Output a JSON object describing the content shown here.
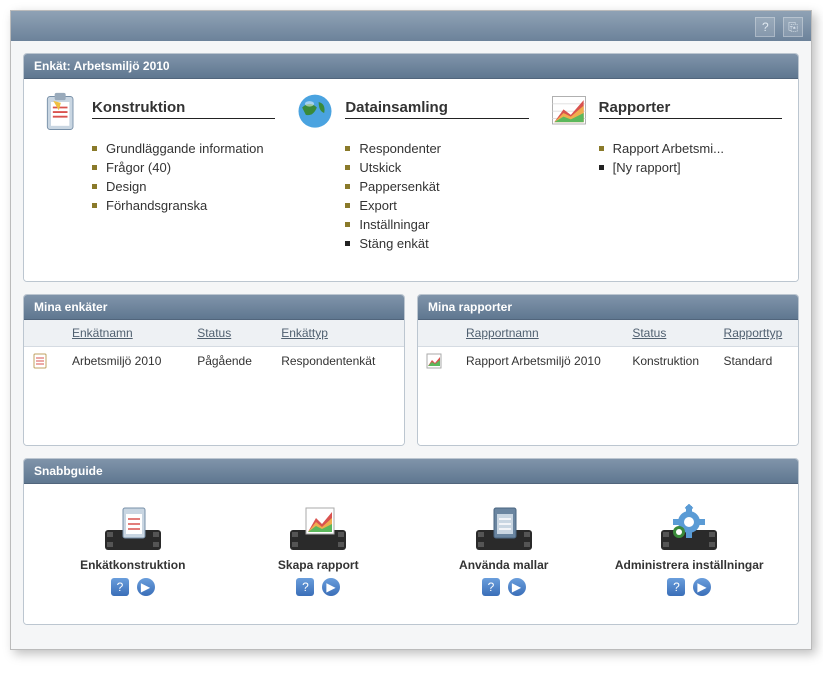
{
  "survey_panel": {
    "title": "Enkät: Arbetsmiljö 2010",
    "sections": [
      {
        "heading": "Konstruktion",
        "items": [
          {
            "label": "Grundläggande information"
          },
          {
            "label": "Frågor (40)"
          },
          {
            "label": "Design"
          },
          {
            "label": "Förhandsgranska"
          }
        ]
      },
      {
        "heading": "Datainsamling",
        "items": [
          {
            "label": "Respondenter"
          },
          {
            "label": "Utskick"
          },
          {
            "label": "Pappersenkät"
          },
          {
            "label": "Export"
          },
          {
            "label": "Inställningar"
          },
          {
            "label": "Stäng enkät",
            "dark": true
          }
        ]
      },
      {
        "heading": "Rapporter",
        "items": [
          {
            "label": "Rapport Arbetsmi..."
          },
          {
            "label": "[Ny rapport]",
            "dark": true
          }
        ]
      }
    ]
  },
  "surveys_panel": {
    "title": "Mina enkäter",
    "columns": {
      "name": "Enkätnamn",
      "status": "Status",
      "type": "Enkättyp"
    },
    "rows": [
      {
        "name": "Arbetsmiljö 2010",
        "status": "Pågående",
        "type": "Respondentenkät"
      }
    ]
  },
  "reports_panel": {
    "title": "Mina rapporter",
    "columns": {
      "name": "Rapportnamn",
      "status": "Status",
      "type": "Rapporttyp"
    },
    "rows": [
      {
        "name": "Rapport Arbetsmiljö 2010",
        "status": "Konstruktion",
        "type": "Standard"
      }
    ]
  },
  "quickguide": {
    "title": "Snabbguide",
    "items": [
      {
        "label": "Enkätkonstruktion"
      },
      {
        "label": "Skapa rapport"
      },
      {
        "label": "Använda mallar"
      },
      {
        "label": "Administrera inställningar"
      }
    ]
  }
}
